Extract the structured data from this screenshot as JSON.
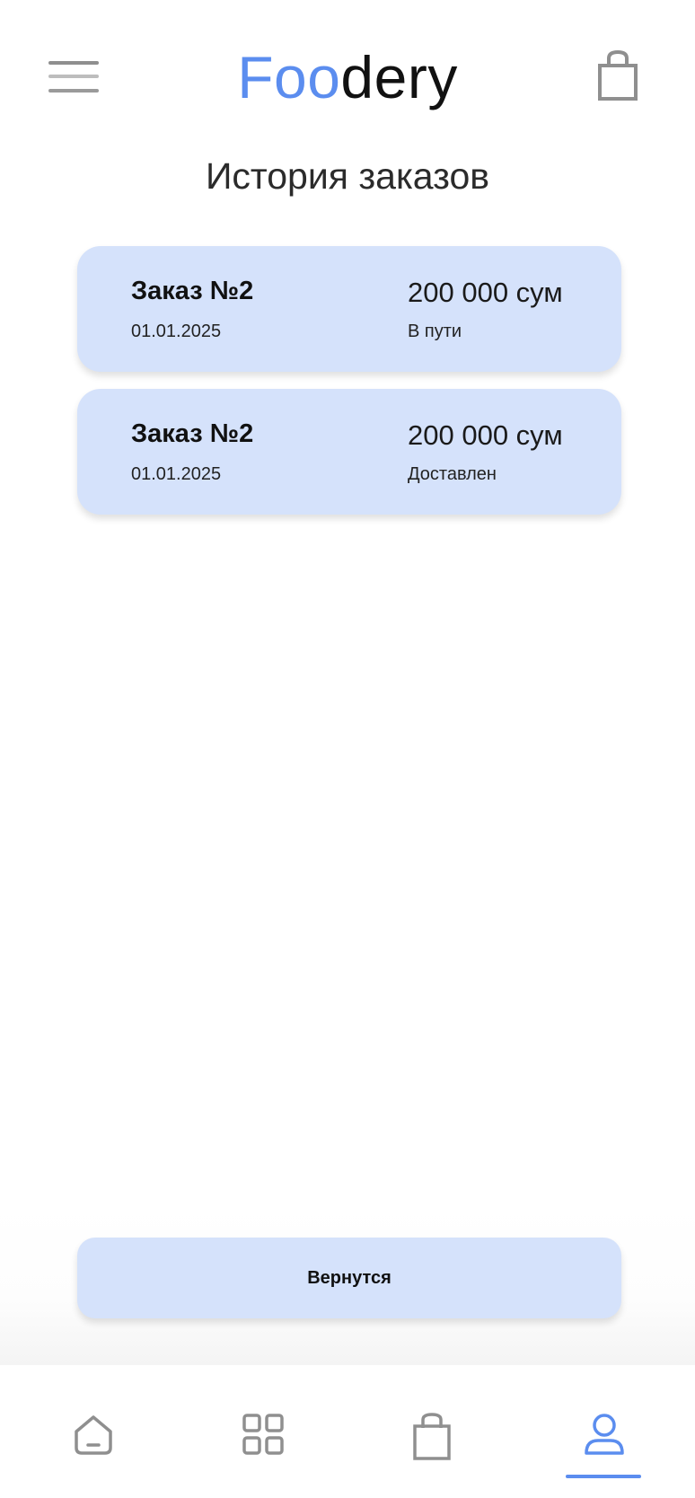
{
  "header": {
    "logo_accent": "Foo",
    "logo_rest": "dery"
  },
  "page": {
    "title": "История заказов"
  },
  "orders": [
    {
      "title": "Заказ №2",
      "date": "01.01.2025",
      "price": "200 000 сум",
      "status": "В пути"
    },
    {
      "title": "Заказ №2",
      "date": "01.01.2025",
      "price": "200 000 сум",
      "status": "Доставлен"
    }
  ],
  "actions": {
    "back_label": "Вернутся"
  },
  "bottom_nav": {
    "items": [
      {
        "icon": "home-icon",
        "active": false
      },
      {
        "icon": "grid-icon",
        "active": false
      },
      {
        "icon": "shopping-bag-icon",
        "active": false
      },
      {
        "icon": "user-icon",
        "active": true
      }
    ]
  },
  "colors": {
    "accent": "#5b8def",
    "card_background": "#d5e2fb",
    "icon_gray": "#8f8f8f"
  }
}
